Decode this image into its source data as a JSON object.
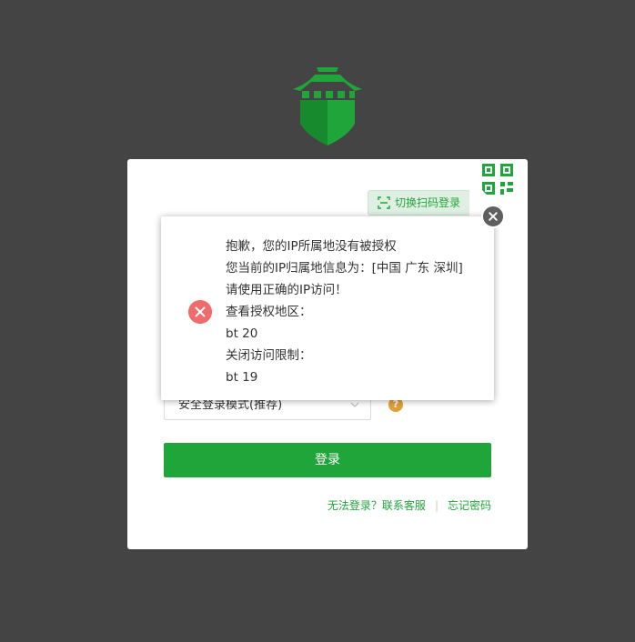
{
  "logo": {
    "icon": "fortress-shield-icon",
    "colors": {
      "primary": "#20a53a",
      "dark": "#188a2e"
    }
  },
  "card": {
    "scan_tip_label": "切换扫码登录",
    "scan_tip_icon": "scan-frame-icon",
    "qr_icon": "qr-code-icon",
    "login_mode_select": {
      "value": "安全登录模式(推荐)"
    },
    "help_icon_glyph": "?",
    "login_button": "登录",
    "links": {
      "cannot_login": "无法登录？联系客服",
      "separator": "|",
      "forgot_password": "忘记密码"
    }
  },
  "dialog": {
    "icon": "error-x-icon",
    "lines": [
      "抱歉，您的IP所属地没有被授权",
      "您当前的IP归属地信息为：[中国 广东 深圳]",
      "请使用正确的IP访问！",
      "查看授权地区：",
      "bt 20",
      "关闭访问限制：",
      "bt 19"
    ],
    "close_icon": "close-icon"
  },
  "colors": {
    "accent": "#20a53a",
    "background": "#444444",
    "error": "#f06b6b"
  }
}
